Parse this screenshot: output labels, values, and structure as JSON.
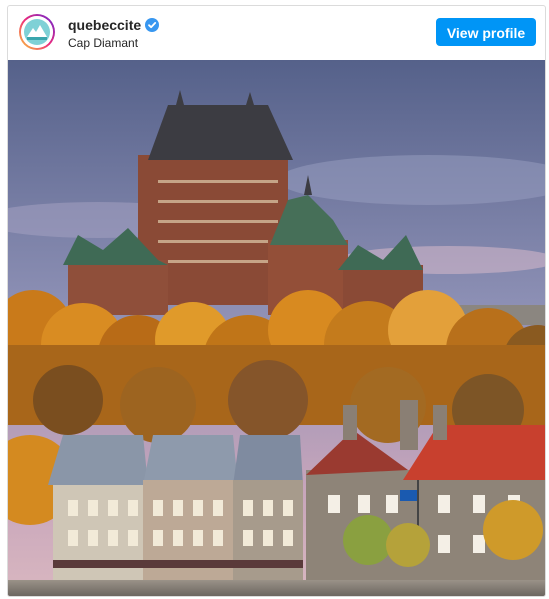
{
  "post": {
    "username": "quebeccite",
    "verified": true,
    "location": "Cap Diamant",
    "view_profile_label": "View profile"
  },
  "photo": {
    "subject": "Château Frontenac above autumn trees and Old Quebec stone houses"
  },
  "colors": {
    "button": "#0095f6",
    "verified_badge": "#3897f0",
    "sky_top": "#5a6890",
    "sky_bottom": "#c9a6b8",
    "foliage": "#d98a1c"
  },
  "icons": [
    "avatar-logo-icon",
    "verified-badge-icon"
  ]
}
